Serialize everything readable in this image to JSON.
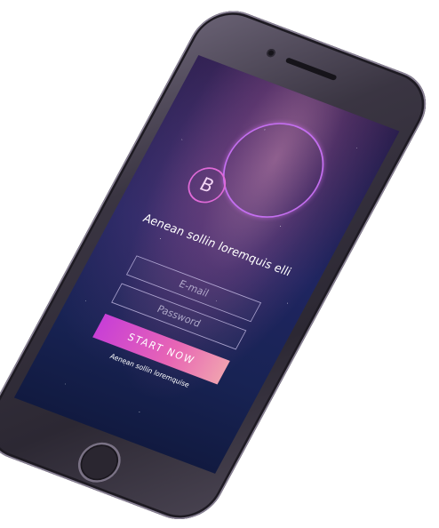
{
  "app": {
    "logo_letter": "B",
    "tagline": "Aenean sollin loremquis elli"
  },
  "form": {
    "email_placeholder": "E-mail",
    "password_placeholder": "Password",
    "start_label": "START NOW",
    "sub_link": "Aenean sollin loremquise"
  },
  "colors": {
    "accent_start": "#c83fd6",
    "accent_end": "#f0a0b0",
    "ring": "#c46ff0"
  },
  "icons": {
    "logo": "circle-logo-icon",
    "home": "home-button-icon",
    "camera": "front-camera-icon",
    "speaker": "earpiece-speaker-icon"
  }
}
